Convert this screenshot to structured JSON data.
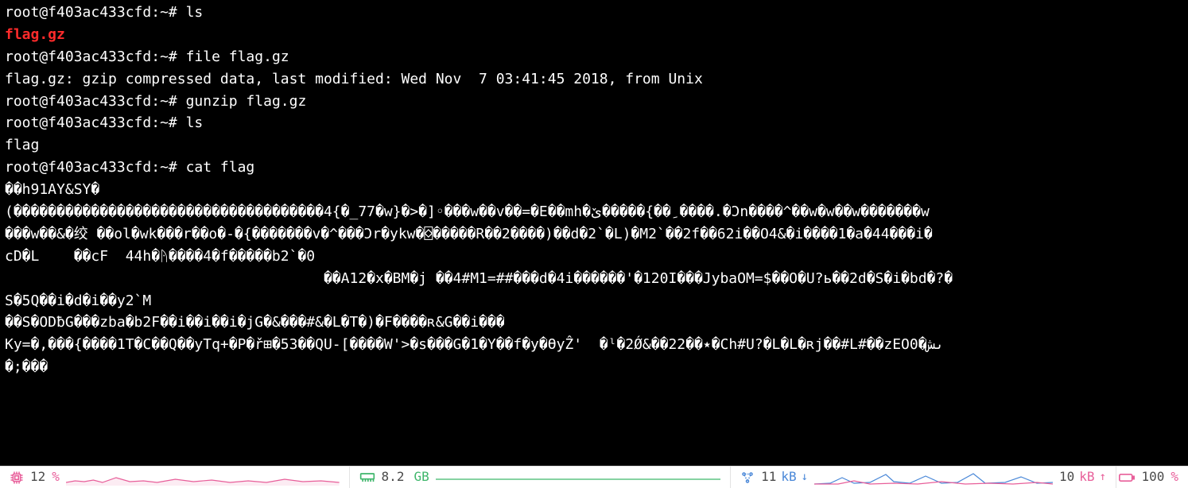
{
  "terminal": {
    "prompt": {
      "user": "root",
      "host": "f403ac433cfd",
      "path": "~",
      "symbol": "#"
    },
    "session": [
      {
        "type": "cmd",
        "text": "ls"
      },
      {
        "type": "out-red",
        "text": "flag.gz"
      },
      {
        "type": "cmd",
        "text": "file flag.gz"
      },
      {
        "type": "out",
        "text": "flag.gz: gzip compressed data, last modified: Wed Nov  7 03:41:45 2018, from Unix"
      },
      {
        "type": "cmd",
        "text": "gunzip flag.gz"
      },
      {
        "type": "cmd",
        "text": "ls"
      },
      {
        "type": "out",
        "text": "flag"
      },
      {
        "type": "cmd",
        "text": "cat flag"
      },
      {
        "type": "bin",
        "text": "��h91AY&SY�"
      },
      {
        "type": "bin",
        "text": "(������������������������������������4{�_77�w}�>�]◦���w��v��=�E��mh�ێ�����{�� ِ����.�Ͻn����^��w�w��w�������w"
      },
      {
        "type": "bin",
        "text": "���w��&�绞 ��ol�wk���r��o�-�{�������v�^���Ͻr�ykw�⌺�����R��2����)��d�2`�L)�M2`��2f��62i��O4&�i����1�a�44���i�"
      },
      {
        "type": "bin",
        "text": "cD�L    ��cF  44h�ᚤ����4�f�����b2`�0"
      },
      {
        "type": "bin",
        "text": "                                     ��A12�x�BM�ј ��4#M1=##���d�4i������'�120I���JybaOM=$��O�U?ь��2d�S�i�bd�?�"
      },
      {
        "type": "bin",
        "text": "S�5Q��i�d�i��y2`M"
      },
      {
        "type": "bin",
        "text": "��S�ODƀG���zba�b2F��i��i��i�jG�&���#&�L�T�)�F����ʀ&G��i���"
      },
      {
        "type": "bin",
        "text": "Ky=�,���{����1T�C��Q��yTq+�P�ř⊞�53��QU-[����W'>�s���G�1�Y��f�y�ϴyẐ'  �ˡ�2Ǿ&��22��٭�Ch#U?�L�L�ʀj��#L#��zEOىش�0"
      },
      {
        "type": "bin",
        "text": "�;���"
      }
    ]
  },
  "statusbar": {
    "cpu": {
      "value": "12",
      "unit": "%"
    },
    "mem": {
      "value": "8.2",
      "unit": "GB"
    },
    "net": {
      "down_value": "11",
      "down_unit": "kB",
      "up_value": "10",
      "up_unit": "kB"
    },
    "battery": {
      "value": "100",
      "unit": "%"
    }
  }
}
